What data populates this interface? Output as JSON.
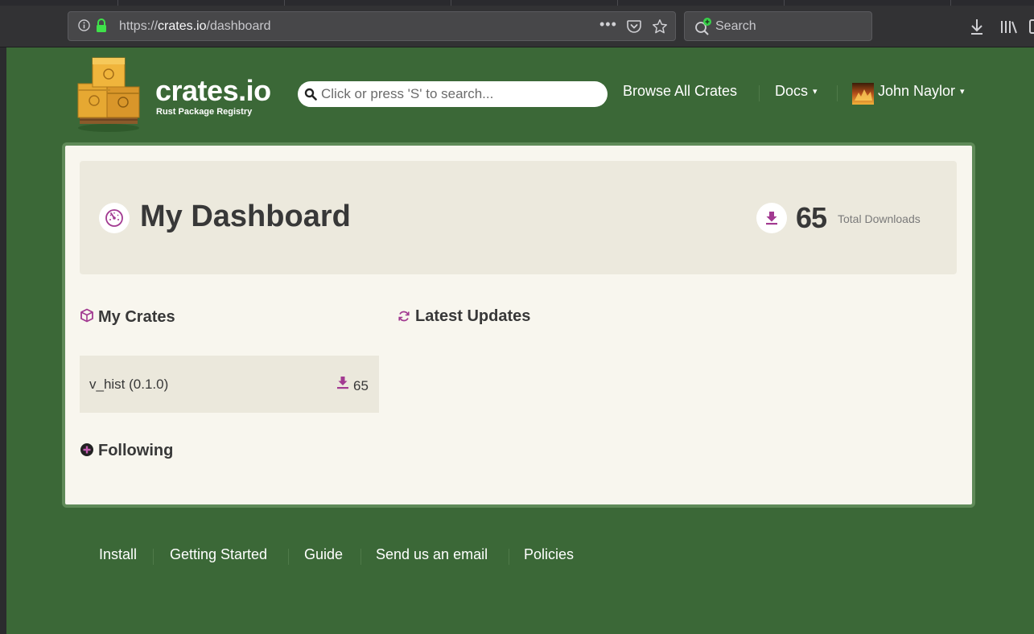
{
  "browser": {
    "url_prefix": "https://",
    "url_domain": "crates.io",
    "url_path": "/dashboard",
    "search_placeholder": "Search",
    "more_dots": "•••"
  },
  "site": {
    "logo_title": "crates.io",
    "logo_subtitle": "Rust Package Registry",
    "search_placeholder": "Click or press 'S' to search...",
    "nav": {
      "browse": "Browse All Crates",
      "docs": "Docs",
      "user": "John Naylor",
      "caret": "▾"
    }
  },
  "dashboard": {
    "title": "My Dashboard",
    "total_downloads": "65",
    "total_downloads_label": "Total Downloads",
    "my_crates_heading": "My Crates",
    "latest_updates_heading": "Latest Updates",
    "following_heading": "Following",
    "crates": [
      {
        "name": "v_hist (0.1.0)",
        "downloads": "65"
      }
    ]
  },
  "footer": {
    "links": [
      "Install",
      "Getting Started",
      "Guide",
      "Send us an email",
      "Policies"
    ]
  },
  "colors": {
    "background_green": "#3b6837",
    "accent_purple": "#a23a91",
    "card": "#f8f6ee",
    "panel": "#ece9dd"
  }
}
